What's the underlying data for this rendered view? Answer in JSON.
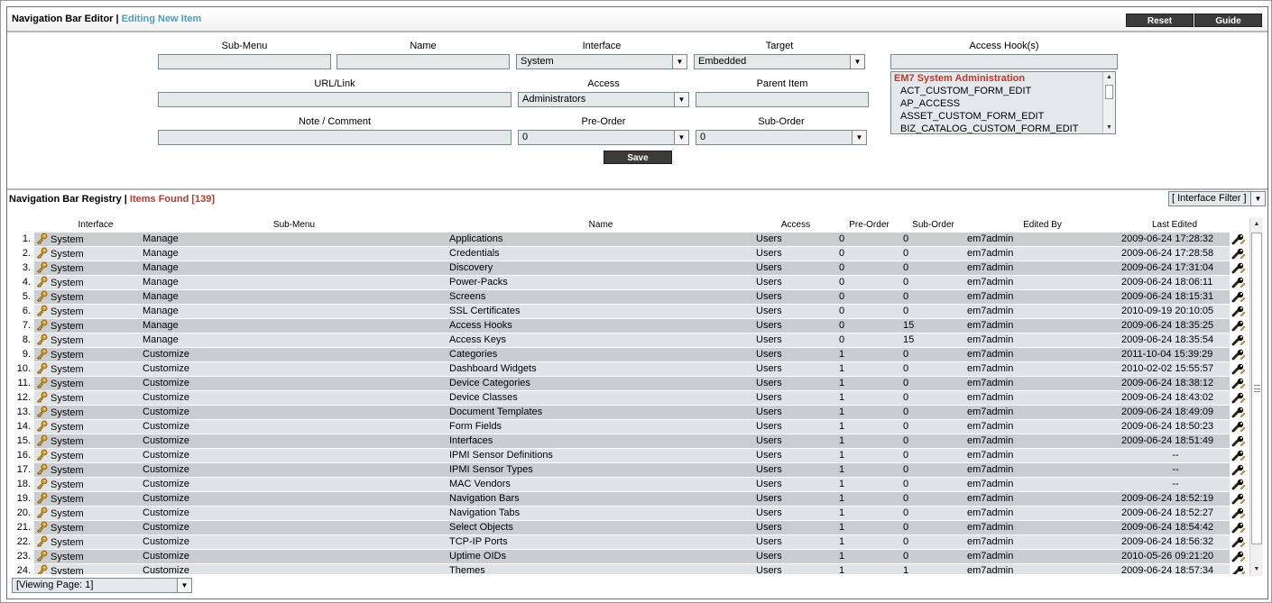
{
  "editor": {
    "title": "Navigation Bar Editor",
    "separator": "|",
    "subtitle": "Editing New Item",
    "reset_label": "Reset",
    "guide_label": "Guide"
  },
  "form": {
    "submenu_label": "Sub-Menu",
    "submenu_value": "",
    "name_label": "Name",
    "name_value": "",
    "interface_label": "Interface",
    "interface_value": "System",
    "target_label": "Target",
    "target_value": "Embedded",
    "access_hooks_label": "Access Hook(s)",
    "access_hooks_filter": "",
    "url_label": "URL/Link",
    "url_value": "",
    "access_label": "Access",
    "access_value": "Administrators",
    "parent_label": "Parent Item",
    "parent_value": "",
    "note_label": "Note / Comment",
    "note_value": "",
    "preorder_label": "Pre-Order",
    "preorder_value": "0",
    "suborder_label": "Sub-Order",
    "suborder_value": "0",
    "save_label": "Save",
    "hooks": [
      "EM7 System Administration",
      "ACT_CUSTOM_FORM_EDIT",
      "AP_ACCESS",
      "ASSET_CUSTOM_FORM_EDIT",
      "BIZ_CATALOG_CUSTOM_FORM_EDIT"
    ]
  },
  "registry": {
    "title": "Navigation Bar Registry",
    "separator": "|",
    "count_text": "Items Found [139]",
    "filter_label": "[ Interface Filter ]",
    "viewing_page": "[Viewing Page: 1]",
    "columns": {
      "interface": "Interface",
      "submenu": "Sub-Menu",
      "name": "Name",
      "access": "Access",
      "preorder": "Pre-Order",
      "suborder": "Sub-Order",
      "edited_by": "Edited By",
      "last_edited": "Last Edited"
    },
    "rows": [
      {
        "num": "1.",
        "interface": "System",
        "submenu": "Manage",
        "name": "Applications",
        "access": "Users",
        "pre": "0",
        "sub": "0",
        "by": "em7admin",
        "edited": "2009-06-24 17:28:32"
      },
      {
        "num": "2.",
        "interface": "System",
        "submenu": "Manage",
        "name": "Credentials",
        "access": "Users",
        "pre": "0",
        "sub": "0",
        "by": "em7admin",
        "edited": "2009-06-24 17:28:58"
      },
      {
        "num": "3.",
        "interface": "System",
        "submenu": "Manage",
        "name": "Discovery",
        "access": "Users",
        "pre": "0",
        "sub": "0",
        "by": "em7admin",
        "edited": "2009-06-24 17:31:04"
      },
      {
        "num": "4.",
        "interface": "System",
        "submenu": "Manage",
        "name": "Power-Packs",
        "access": "Users",
        "pre": "0",
        "sub": "0",
        "by": "em7admin",
        "edited": "2009-06-24 18:06:11"
      },
      {
        "num": "5.",
        "interface": "System",
        "submenu": "Manage",
        "name": "Screens",
        "access": "Users",
        "pre": "0",
        "sub": "0",
        "by": "em7admin",
        "edited": "2009-06-24 18:15:31"
      },
      {
        "num": "6.",
        "interface": "System",
        "submenu": "Manage",
        "name": "SSL Certificates",
        "access": "Users",
        "pre": "0",
        "sub": "0",
        "by": "em7admin",
        "edited": "2010-09-19 20:10:05"
      },
      {
        "num": "7.",
        "interface": "System",
        "submenu": "Manage",
        "name": "Access Hooks",
        "access": "Users",
        "pre": "0",
        "sub": "15",
        "by": "em7admin",
        "edited": "2009-06-24 18:35:25"
      },
      {
        "num": "8.",
        "interface": "System",
        "submenu": "Manage",
        "name": "Access Keys",
        "access": "Users",
        "pre": "0",
        "sub": "15",
        "by": "em7admin",
        "edited": "2009-06-24 18:35:54"
      },
      {
        "num": "9.",
        "interface": "System",
        "submenu": "Customize",
        "name": "Categories",
        "access": "Users",
        "pre": "1",
        "sub": "0",
        "by": "em7admin",
        "edited": "2011-10-04 15:39:29"
      },
      {
        "num": "10.",
        "interface": "System",
        "submenu": "Customize",
        "name": "Dashboard Widgets",
        "access": "Users",
        "pre": "1",
        "sub": "0",
        "by": "em7admin",
        "edited": "2010-02-02 15:55:57"
      },
      {
        "num": "11.",
        "interface": "System",
        "submenu": "Customize",
        "name": "Device Categories",
        "access": "Users",
        "pre": "1",
        "sub": "0",
        "by": "em7admin",
        "edited": "2009-06-24 18:38:12"
      },
      {
        "num": "12.",
        "interface": "System",
        "submenu": "Customize",
        "name": "Device Classes",
        "access": "Users",
        "pre": "1",
        "sub": "0",
        "by": "em7admin",
        "edited": "2009-06-24 18:43:02"
      },
      {
        "num": "13.",
        "interface": "System",
        "submenu": "Customize",
        "name": "Document Templates",
        "access": "Users",
        "pre": "1",
        "sub": "0",
        "by": "em7admin",
        "edited": "2009-06-24 18:49:09"
      },
      {
        "num": "14.",
        "interface": "System",
        "submenu": "Customize",
        "name": "Form Fields",
        "access": "Users",
        "pre": "1",
        "sub": "0",
        "by": "em7admin",
        "edited": "2009-06-24 18:50:23"
      },
      {
        "num": "15.",
        "interface": "System",
        "submenu": "Customize",
        "name": "Interfaces",
        "access": "Users",
        "pre": "1",
        "sub": "0",
        "by": "em7admin",
        "edited": "2009-06-24 18:51:49"
      },
      {
        "num": "16.",
        "interface": "System",
        "submenu": "Customize",
        "name": "IPMI Sensor Definitions",
        "access": "Users",
        "pre": "1",
        "sub": "0",
        "by": "em7admin",
        "edited": "--"
      },
      {
        "num": "17.",
        "interface": "System",
        "submenu": "Customize",
        "name": "IPMI Sensor Types",
        "access": "Users",
        "pre": "1",
        "sub": "0",
        "by": "em7admin",
        "edited": "--"
      },
      {
        "num": "18.",
        "interface": "System",
        "submenu": "Customize",
        "name": "MAC Vendors",
        "access": "Users",
        "pre": "1",
        "sub": "0",
        "by": "em7admin",
        "edited": "--"
      },
      {
        "num": "19.",
        "interface": "System",
        "submenu": "Customize",
        "name": "Navigation Bars",
        "access": "Users",
        "pre": "1",
        "sub": "0",
        "by": "em7admin",
        "edited": "2009-06-24 18:52:19"
      },
      {
        "num": "20.",
        "interface": "System",
        "submenu": "Customize",
        "name": "Navigation Tabs",
        "access": "Users",
        "pre": "1",
        "sub": "0",
        "by": "em7admin",
        "edited": "2009-06-24 18:52:27"
      },
      {
        "num": "21.",
        "interface": "System",
        "submenu": "Customize",
        "name": "Select Objects",
        "access": "Users",
        "pre": "1",
        "sub": "0",
        "by": "em7admin",
        "edited": "2009-06-24 18:54:42"
      },
      {
        "num": "22.",
        "interface": "System",
        "submenu": "Customize",
        "name": "TCP-IP Ports",
        "access": "Users",
        "pre": "1",
        "sub": "0",
        "by": "em7admin",
        "edited": "2009-06-24 18:56:32"
      },
      {
        "num": "23.",
        "interface": "System",
        "submenu": "Customize",
        "name": "Uptime OIDs",
        "access": "Users",
        "pre": "1",
        "sub": "0",
        "by": "em7admin",
        "edited": "2010-05-26 09:21:20"
      },
      {
        "num": "24.",
        "interface": "System",
        "submenu": "Customize",
        "name": "Themes",
        "access": "Users",
        "pre": "1",
        "sub": "1",
        "by": "em7admin",
        "edited": "2009-06-24 18:57:34"
      }
    ]
  },
  "icons": {
    "row_icon": "key-icon",
    "row_action": "edit-wrench-icon",
    "dropdown": "chevron-down-icon"
  },
  "colors": {
    "accent_blue": "#4f9fc1",
    "accent_red": "#c0392b",
    "row_dark": "#c9cdd0",
    "row_light": "#dfe3e6",
    "input_bg": "#e3e8eb",
    "button_bg": "#3b3b3b"
  }
}
